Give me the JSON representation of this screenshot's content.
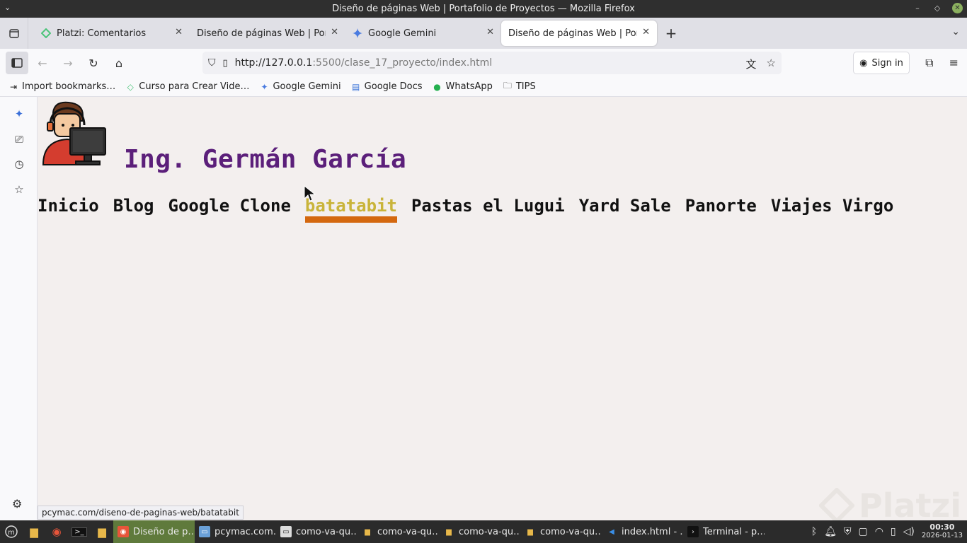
{
  "window": {
    "title": "Diseño de páginas Web | Portafolio de Proyectos — Mozilla Firefox"
  },
  "tabs": [
    {
      "label": "Platzi: Comentarios",
      "icon": "platzi-icon",
      "active": false
    },
    {
      "label": "Diseño de páginas Web | Portafolio",
      "icon": "none",
      "active": false
    },
    {
      "label": "Google Gemini",
      "icon": "gemini-icon",
      "active": false
    },
    {
      "label": "Diseño de páginas Web | Portafolio",
      "icon": "none",
      "active": true
    }
  ],
  "navbar": {
    "url_host": "http://127.0.0.1",
    "url_rest": ":5500/clase_17_proyecto/index.html",
    "signin_label": "Sign in"
  },
  "bookmarks": [
    {
      "label": "Import bookmarks…",
      "icon": "import-icon"
    },
    {
      "label": "Curso para Crear Vide…",
      "icon": "platzi-icon"
    },
    {
      "label": "Google Gemini",
      "icon": "gemini-icon"
    },
    {
      "label": "Google Docs",
      "icon": "docs-icon"
    },
    {
      "label": "WhatsApp",
      "icon": "whatsapp-icon"
    },
    {
      "label": "TIPS",
      "icon": "folder-icon"
    }
  ],
  "page": {
    "title": "Ing. Germán García",
    "nav": [
      {
        "label": "Inicio",
        "hover": false
      },
      {
        "label": "Blog",
        "hover": false
      },
      {
        "label": "Google Clone",
        "hover": false
      },
      {
        "label": "batatabit",
        "hover": true
      },
      {
        "label": "Pastas el Lugui",
        "hover": false
      },
      {
        "label": "Yard Sale",
        "hover": false
      },
      {
        "label": "Panorte",
        "hover": false
      },
      {
        "label": "Viajes Virgo",
        "hover": false
      }
    ],
    "status_link": "pcymac.com/diseno-de-paginas-web/batatabit",
    "watermark": "Platzi"
  },
  "taskbar": {
    "items": [
      {
        "label": "Diseño de p…",
        "active": true
      },
      {
        "label": "pcymac.com…",
        "active": false
      },
      {
        "label": "como-va-qu…",
        "active": false
      },
      {
        "label": "como-va-qu…",
        "active": false
      },
      {
        "label": "como-va-qu…",
        "active": false
      },
      {
        "label": "como-va-qu…",
        "active": false
      },
      {
        "label": "index.html - …",
        "active": false
      },
      {
        "label": "Terminal - p…",
        "active": false
      }
    ],
    "time": "00:30",
    "date": "2026-01-13"
  },
  "colors": {
    "title_purple": "#5b1f7a",
    "hover_text": "#c9b43a",
    "hover_underline": "#d4680f",
    "page_bg": "#f3efee"
  }
}
